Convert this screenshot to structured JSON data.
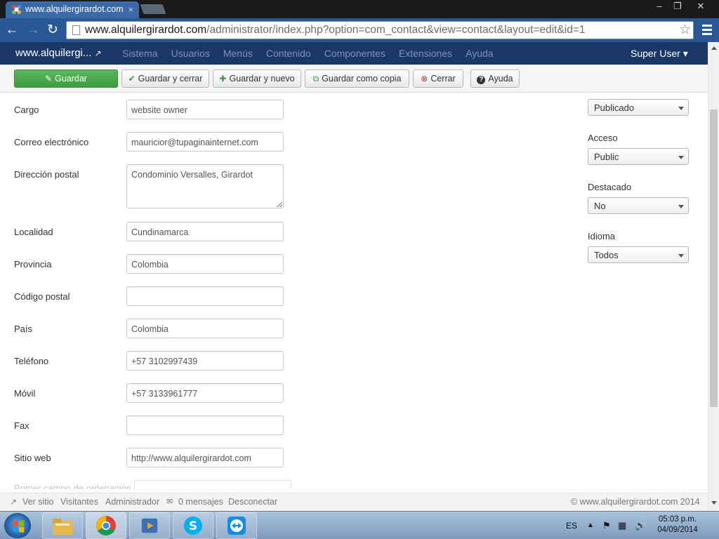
{
  "browser": {
    "tab_title": "www.alquilergirardot.com",
    "tab_close": "×",
    "url_domain": "www.alquilergirardot.com",
    "url_path": "/administrator/index.php?option=com_contact&view=contact&layout=edit&id=1",
    "window_controls": [
      "–",
      "❐",
      "✕"
    ],
    "back": "←",
    "forward": "→",
    "reload": "↻",
    "bookmark_star": "☆"
  },
  "nav": {
    "brand": "www.alquilergi...",
    "external_icon": "↗",
    "menu": [
      "Sistema",
      "Usuarios",
      "Menús",
      "Contenido",
      "Componentes",
      "Extensiones",
      "Ayuda"
    ],
    "user": "Super User ▾"
  },
  "toolbar": {
    "save": "Guardar",
    "save_close": "Guardar y cerrar",
    "save_new": "Guardar y nuevo",
    "save_copy": "Guardar como copia",
    "close": "Cerrar",
    "help": "Ayuda",
    "icons": {
      "save": "✎",
      "save_close": "✔",
      "save_new": "✚",
      "save_copy": "⧉",
      "close": "⊗",
      "help": "?"
    }
  },
  "form": {
    "fields": [
      {
        "label": "Cargo",
        "value": "website owner"
      },
      {
        "label": "Correo electrónico",
        "value": "mauricior@tupaginainternet.com"
      },
      {
        "label": "Dirección postal",
        "value": "Condominio Versalles, Girardot"
      },
      {
        "label": "Localidad",
        "value": "Cundinamarca"
      },
      {
        "label": "Provincia",
        "value": "Colombia"
      },
      {
        "label": "Código postal",
        "value": ""
      },
      {
        "label": "País",
        "value": "Colombia"
      },
      {
        "label": "Teléfono",
        "value": "+57 3102997439"
      },
      {
        "label": "Móvil",
        "value": "+57 3133961777"
      },
      {
        "label": "Fax",
        "value": ""
      },
      {
        "label": "Sitio web",
        "value": "http://www.alquilergirardot.com"
      }
    ],
    "partial_label": "Primer campo de ordenación"
  },
  "sidebar": {
    "status": "Publicado",
    "access_label": "Acceso",
    "access": "Public",
    "featured_label": "Destacado",
    "featured": "No",
    "language_label": "Idioma",
    "language": "Todos"
  },
  "status": {
    "view_site": "Ver sitio",
    "visitors": "Visitantes",
    "admin": "Administrador",
    "messages": "0 mensajes",
    "logout": "Desconectar",
    "copyright": "© www.alquilergirardot.com 2014"
  },
  "taskbar": {
    "lang": "ES",
    "time": "05:03 p.m.",
    "date": "04/09/2014"
  },
  "colors": {
    "chrome_blue": "#2a5896",
    "joomla_nav": "#1a3867",
    "save_green": "#46a546"
  }
}
